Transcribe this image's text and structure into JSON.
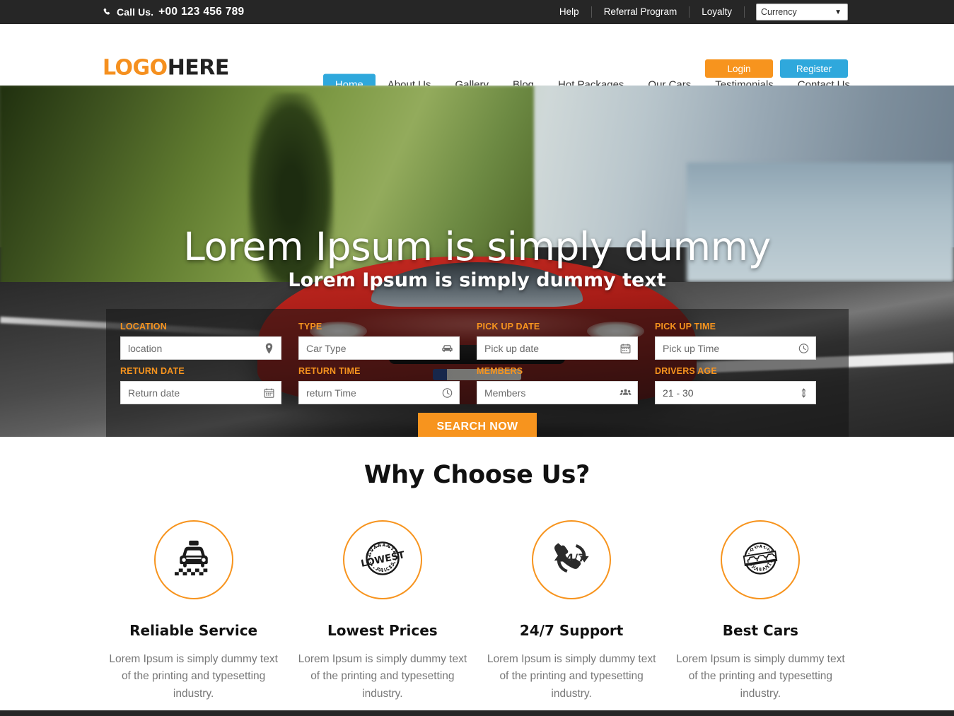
{
  "topbar": {
    "call_label": "Call Us.",
    "phone": "+00 123 456 789",
    "phone_icon": "phone-icon",
    "links": [
      {
        "label": "Help"
      },
      {
        "label": "Referral Program"
      },
      {
        "label": "Loyalty"
      }
    ],
    "currency": {
      "value": "Currency",
      "caret": "▼"
    }
  },
  "header": {
    "logo_first": "LOGO",
    "logo_second": "HERE",
    "login_label": "Login",
    "register_label": "Register",
    "nav": [
      {
        "label": "Home",
        "active": true
      },
      {
        "label": "About Us",
        "active": false
      },
      {
        "label": "Gallery",
        "active": false
      },
      {
        "label": "Blog",
        "active": false
      },
      {
        "label": "Hot Packages",
        "active": false
      },
      {
        "label": "Our Cars",
        "active": false
      },
      {
        "label": "Testimonials",
        "active": false
      },
      {
        "label": "Contact Us",
        "active": false
      }
    ]
  },
  "hero": {
    "title": "Lorem Ipsum is simply dummy",
    "subtitle": "Lorem Ipsum is simply dummy text"
  },
  "search_form": {
    "fields": [
      {
        "label": "LOCATION",
        "placeholder": "location",
        "value": "",
        "icon": "map-pin-icon"
      },
      {
        "label": "TYPE",
        "placeholder": "Car Type",
        "value": "",
        "icon": "car-icon"
      },
      {
        "label": "PICK UP DATE",
        "placeholder": "Pick up date",
        "value": "",
        "icon": "calendar-icon"
      },
      {
        "label": "PICK UP TIME",
        "placeholder": "Pick up Time",
        "value": "",
        "icon": "clock-icon"
      },
      {
        "label": "RETURN DATE",
        "placeholder": "Return date",
        "value": "",
        "icon": "calendar-icon"
      },
      {
        "label": "RETURN TIME",
        "placeholder": "return Time",
        "value": "",
        "icon": "clock-icon"
      },
      {
        "label": "MEMBERS",
        "placeholder": "Members",
        "value": "",
        "icon": "users-icon"
      },
      {
        "label": "DRIVERS AGE",
        "placeholder": "",
        "value": "21 - 30",
        "icon": "updown-arrows-icon"
      }
    ],
    "search_button": "SEARCH NOW"
  },
  "why": {
    "heading": "Why Choose Us?",
    "features": [
      {
        "icon": "taxi-icon",
        "title": "Reliable Service",
        "text": "Lorem Ipsum is simply dummy text of the printing and typesetting industry."
      },
      {
        "icon": "lowest-price-badge-icon",
        "title": "Lowest Prices",
        "text": "Lorem Ipsum is simply dummy text of the printing and typesetting industry."
      },
      {
        "icon": "support-247-icon",
        "title": "24/7 Support",
        "text": "Lorem Ipsum is simply dummy text of the printing and typesetting industry."
      },
      {
        "icon": "quality-guaranteed-badge-icon",
        "title": "Best Cars",
        "text": "Lorem Ipsum is simply dummy text of the printing and typesetting industry."
      }
    ]
  },
  "colors": {
    "orange": "#f7941e",
    "blue": "#2fa8dc",
    "dark": "#262626",
    "body_text": "#777777"
  }
}
